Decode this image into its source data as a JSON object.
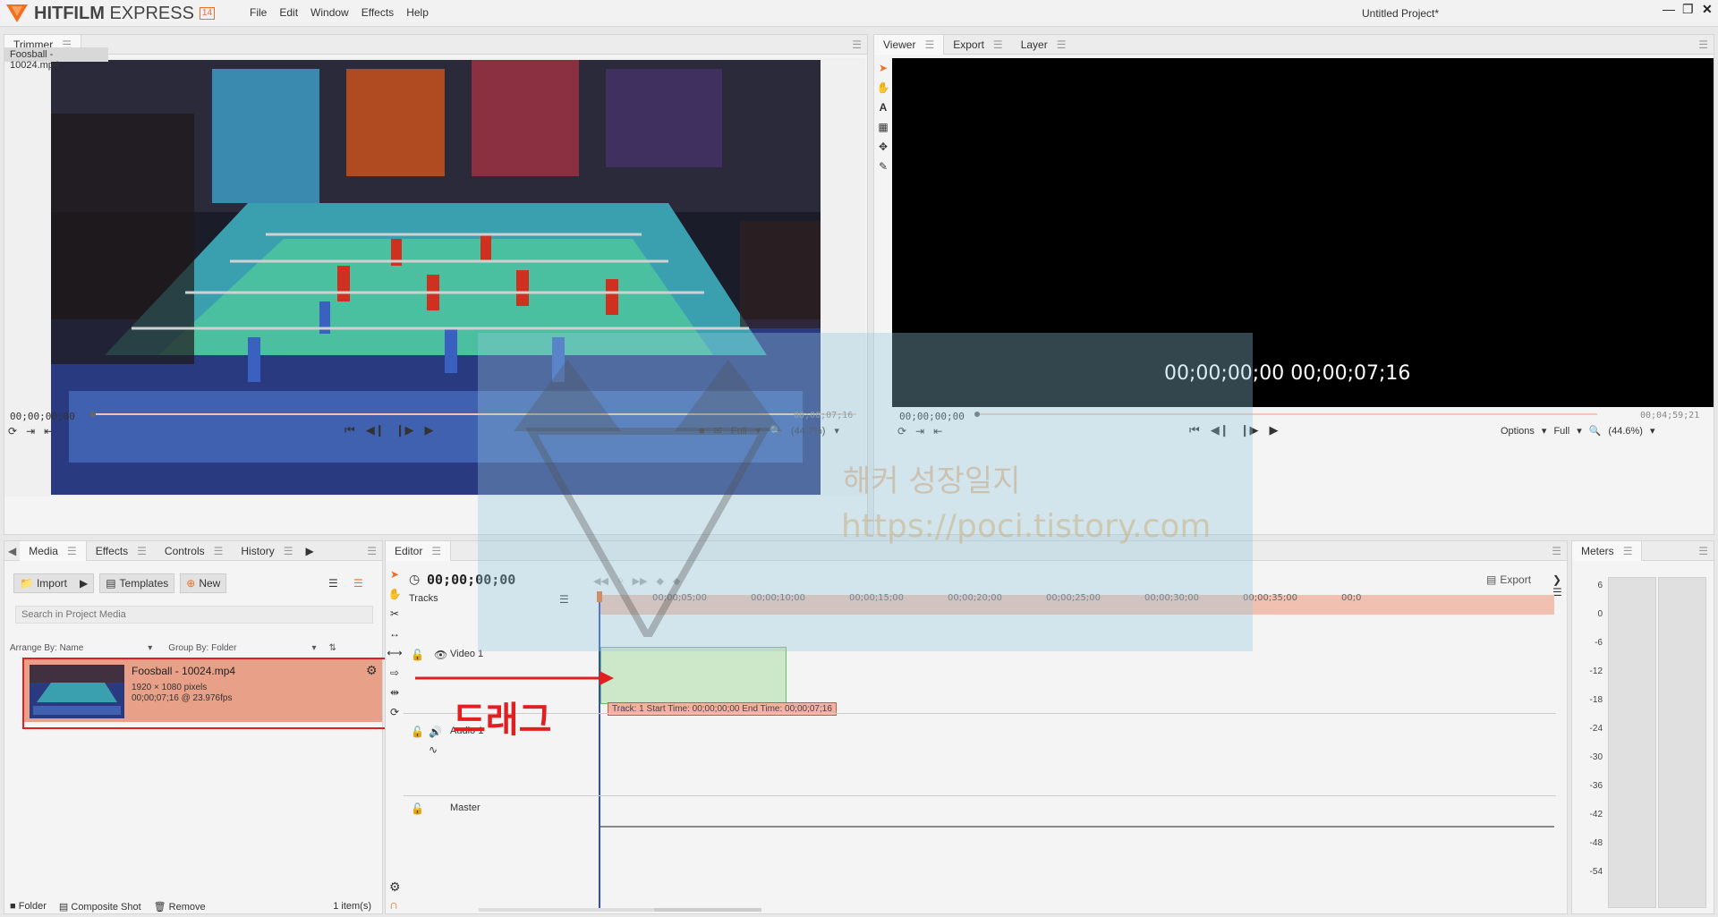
{
  "app": {
    "name_part1": "HITFILM",
    "name_part2": "EXPRESS",
    "version": "14",
    "project_title": "Untitled Project*"
  },
  "menu": [
    "File",
    "Edit",
    "Window",
    "Effects",
    "Help"
  ],
  "trimmer": {
    "tab": "Trimmer",
    "clip_label": "Foosball - 10024.mp4",
    "tc_left": "00;00;00;00",
    "tc_right": "00;00;07;16",
    "quality": "Full",
    "zoom": "(44.7%)"
  },
  "viewer": {
    "tabs": [
      "Viewer",
      "Export",
      "Layer"
    ],
    "overlay_tc": "00;00;00;00 00;00;07;16",
    "tc_left": "00;00;00;00",
    "tc_right": "00;04;59;21",
    "options": "Options",
    "quality": "Full",
    "zoom": "(44.6%)"
  },
  "media": {
    "tabs": [
      "Media",
      "Effects",
      "Controls",
      "History"
    ],
    "import": "Import",
    "templates": "Templates",
    "new": "New",
    "search_placeholder": "Search in Project Media",
    "arrange": "Arrange By: Name",
    "group": "Group By: Folder",
    "item": {
      "name": "Foosball - 10024.mp4",
      "res": "1920 × 1080 pixels",
      "info": "00;00;07;16 @ 23.976fps"
    },
    "footer": {
      "folder": "Folder",
      "composite": "Composite Shot",
      "remove": "Remove",
      "count": "1 item(s)"
    }
  },
  "editor": {
    "tab": "Editor",
    "timecode": "00;00;00;00",
    "export": "Export",
    "tracks_label": "Tracks",
    "video_track": "Video 1",
    "audio_track": "Audio 1",
    "master": "Master",
    "ruler": [
      "00;00;05;00",
      "00;00;10;00",
      "00;00;15;00",
      "00;00;20;00",
      "00;00;25;00",
      "00;00;30;00",
      "00;00;35;00",
      "00;0"
    ],
    "tooltip": "Track: 1 Start Time: 00;00;00;00 End Time: 00;00;07;16"
  },
  "meters": {
    "tab": "Meters",
    "labels": [
      "6",
      "0",
      "-6",
      "-12",
      "-18",
      "-24",
      "-30",
      "-36",
      "-42",
      "-48",
      "-54"
    ]
  },
  "annotation": {
    "drag_label": "드래그"
  },
  "watermark": {
    "title": "해커 성장일지",
    "url": "https://poci.tistory.com"
  },
  "colors": {
    "accent": "#f36e21",
    "selection": "#e8a088",
    "annotation_red": "#e02020",
    "clip_green": "#cde8c8"
  }
}
